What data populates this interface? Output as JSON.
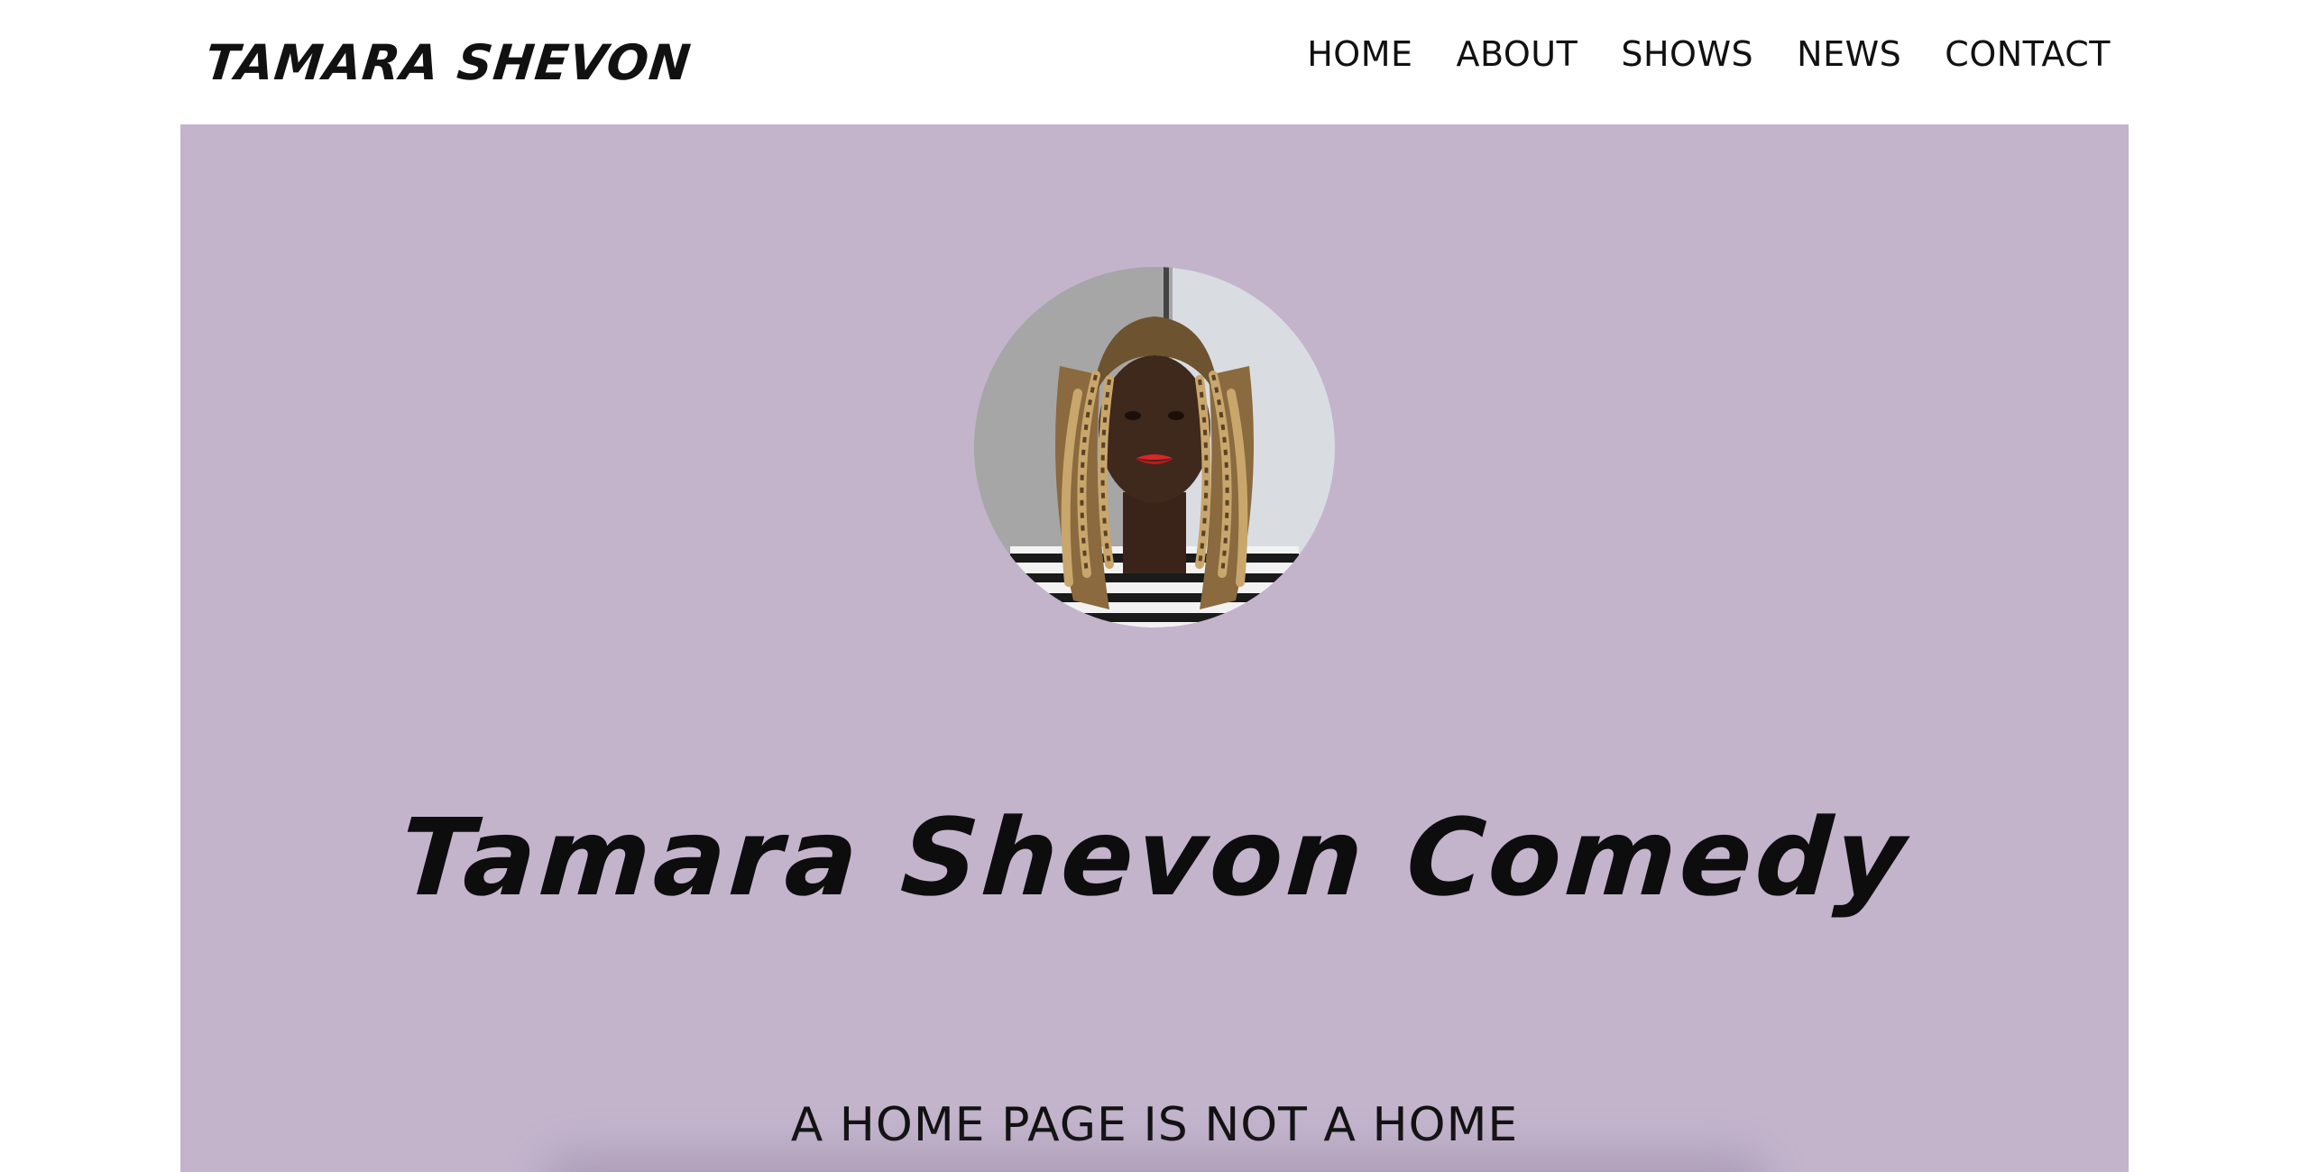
{
  "header": {
    "brand": "TAMARA SHEVON",
    "nav": [
      {
        "label": "HOME"
      },
      {
        "label": "ABOUT"
      },
      {
        "label": "SHOWS"
      },
      {
        "label": "NEWS"
      },
      {
        "label": "CONTACT"
      }
    ]
  },
  "hero": {
    "background_color": "#c3b4cc",
    "avatar": "portrait-photo",
    "title": "Tamara Shevon Comedy",
    "subtitle": "A HOME PAGE IS NOT A HOME"
  }
}
